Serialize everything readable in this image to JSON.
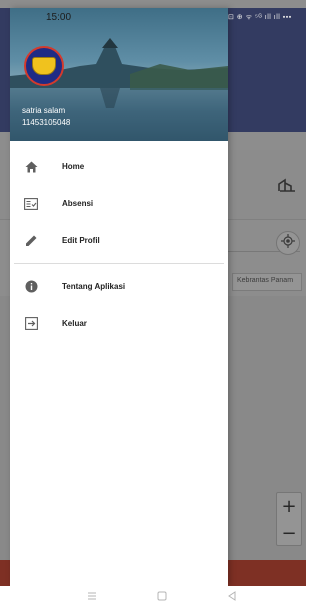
{
  "status_bar": {
    "time": "15:00",
    "icons": "⊡ ⊕ ᯤ ⁵ᴳ ıll ıll ▪▪▪"
  },
  "drawer": {
    "header": {
      "user_name": "satria salam",
      "user_id": "11453105048"
    },
    "items": [
      {
        "label": "Home",
        "icon": "home-icon"
      },
      {
        "label": "Absensi",
        "icon": "attendance-list-icon"
      },
      {
        "label": "Edit Profil",
        "icon": "pencil-icon"
      }
    ],
    "secondary_items": [
      {
        "label": "Tentang Aplikasi",
        "icon": "info-icon"
      },
      {
        "label": "Keluar",
        "icon": "logout-icon"
      }
    ]
  },
  "background_app": {
    "location_text": "Kebrantas Panam"
  },
  "map_controls": {
    "zoom_in": "+",
    "zoom_out": "−"
  },
  "colors": {
    "header_purple": "#5867a8",
    "bottom_bar_red": "#d9533f",
    "drawer_bg": "#ffffff"
  }
}
